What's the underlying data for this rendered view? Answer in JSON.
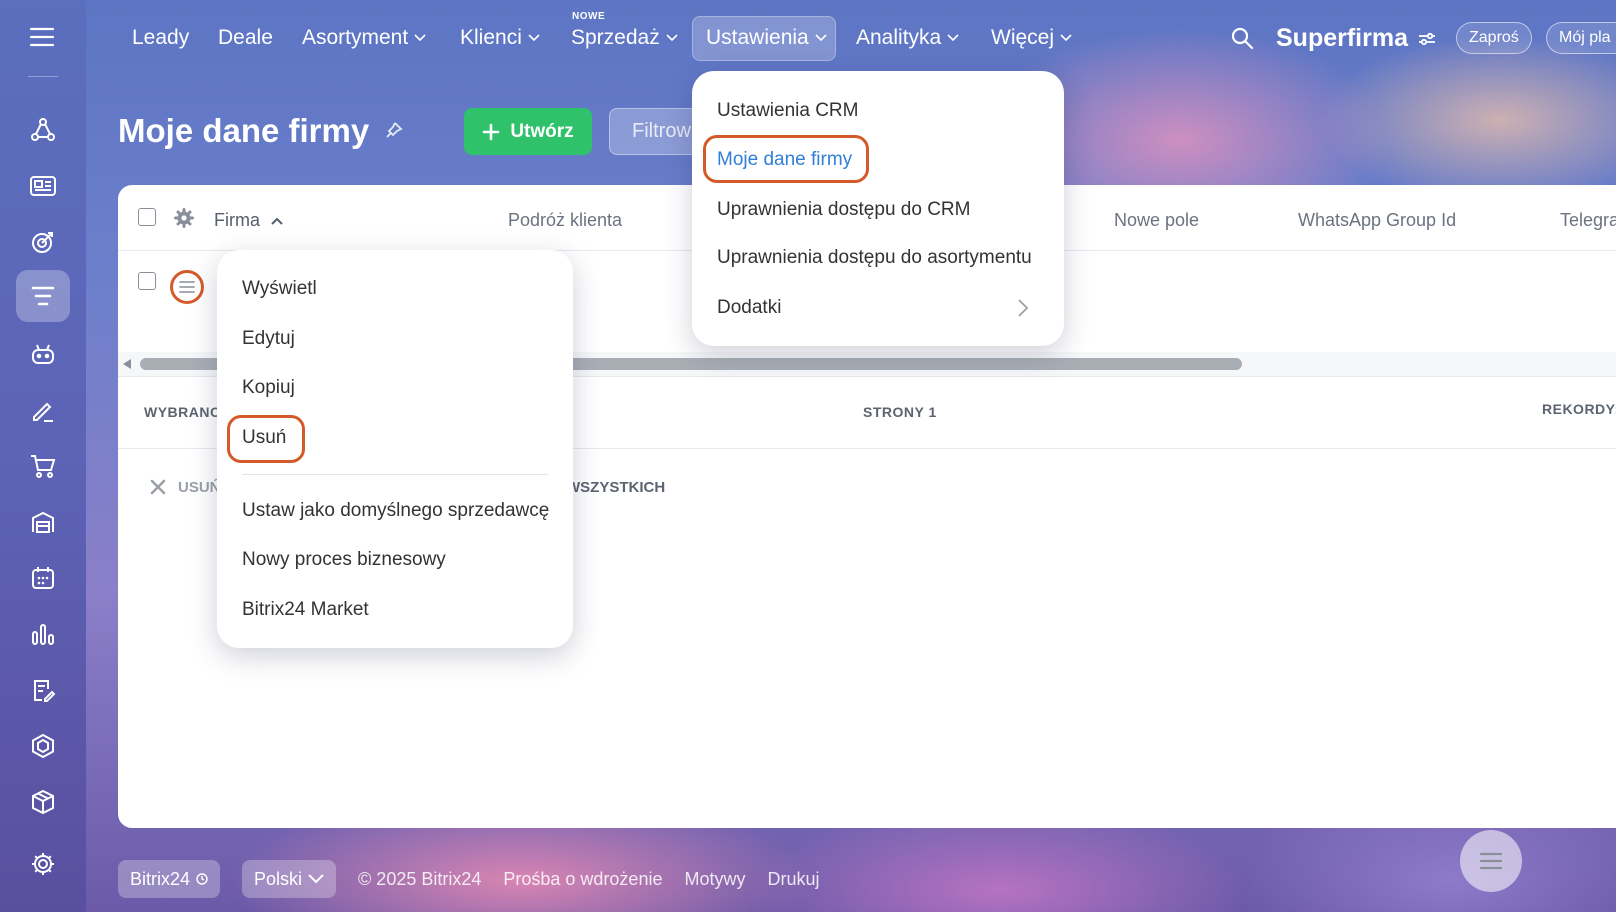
{
  "nav": {
    "items": [
      {
        "label": "Leady"
      },
      {
        "label": "Deale"
      },
      {
        "label": "Asortyment"
      },
      {
        "label": "Klienci"
      },
      {
        "label": "Sprzedaż"
      },
      {
        "label": "Ustawienia"
      },
      {
        "label": "Analityka"
      },
      {
        "label": "Więcej"
      }
    ],
    "new_badge": "NOWE",
    "brand": "Superfirma",
    "invite": "Zaproś",
    "my_plan": "Mój pla"
  },
  "page": {
    "title": "Moje dane firmy",
    "create_label": "Utwórz",
    "filter_placeholder": "Filtrow"
  },
  "grid": {
    "headers": [
      "Firma",
      "Podróż klienta",
      "Nowe pole",
      "WhatsApp Group Id",
      "Telegra"
    ],
    "selected_label": "WYBRANO",
    "pages_label": "STRONY 1",
    "records_label": "REKORDY:",
    "delete_label": "USUŃ",
    "all_label": "WSZYSTKICH"
  },
  "settings_menu": {
    "items": [
      {
        "label": "Ustawienia CRM"
      },
      {
        "label": "Moje dane firmy",
        "highlighted": true
      },
      {
        "label": "Uprawnienia dostępu do CRM"
      },
      {
        "label": "Uprawnienia dostępu do asortymentu"
      },
      {
        "label": "Dodatki"
      }
    ]
  },
  "row_menu": {
    "items": [
      {
        "label": "Wyświetl"
      },
      {
        "label": "Edytuj"
      },
      {
        "label": "Kopiuj"
      },
      {
        "label": "Usuń",
        "highlighted": true
      },
      {
        "label": "Ustaw jako domyślnego sprzedawcę"
      },
      {
        "label": "Nowy proces biznesowy"
      },
      {
        "label": "Bitrix24 Market"
      }
    ]
  },
  "footer": {
    "brand": "Bitrix24",
    "language": "Polski",
    "copyright": "© 2025 Bitrix24",
    "links": [
      "Prośba o wdrożenie",
      "Motywy",
      "Drukuj"
    ]
  },
  "colors": {
    "accent_green": "#2fc26b",
    "highlight_outline": "#d45a2a",
    "link_blue": "#2f7fd6"
  }
}
